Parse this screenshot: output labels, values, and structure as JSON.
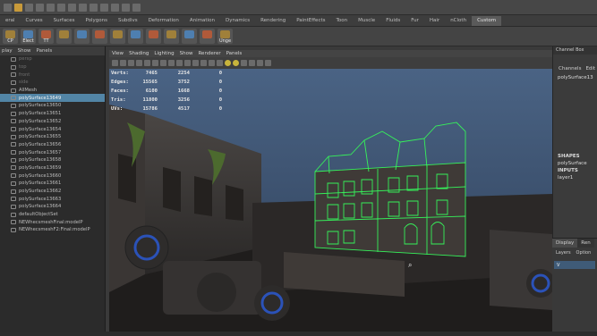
{
  "shelf_tabs": [
    {
      "label": "eral"
    },
    {
      "label": "Curves"
    },
    {
      "label": "Surfaces"
    },
    {
      "label": "Polygons"
    },
    {
      "label": "Subdivs"
    },
    {
      "label": "Deformation"
    },
    {
      "label": "Animation"
    },
    {
      "label": "Dynamics"
    },
    {
      "label": "Rendering"
    },
    {
      "label": "PaintEffects"
    },
    {
      "label": "Toon"
    },
    {
      "label": "Muscle"
    },
    {
      "label": "Fluids"
    },
    {
      "label": "Fur"
    },
    {
      "label": "Hair"
    },
    {
      "label": "nCloth"
    },
    {
      "label": "Custom"
    }
  ],
  "active_shelf_tab": "Custom",
  "shelf_buttons": [
    {
      "label": "CP"
    },
    {
      "label": "Elect"
    },
    {
      "label": "TT"
    },
    {
      "label": ""
    },
    {
      "label": ""
    },
    {
      "label": ""
    },
    {
      "label": ""
    },
    {
      "label": ""
    },
    {
      "label": ""
    },
    {
      "label": ""
    },
    {
      "label": ""
    },
    {
      "label": ""
    },
    {
      "label": "Unge"
    }
  ],
  "outliner": {
    "menu": [
      "play",
      "Show",
      "Panels"
    ],
    "rows": [
      {
        "label": "persp",
        "state": "dim"
      },
      {
        "label": "top",
        "state": "dim"
      },
      {
        "label": "front",
        "state": "dim"
      },
      {
        "label": "side",
        "state": "dim"
      },
      {
        "label": "AllMesh",
        "state": "normal"
      },
      {
        "label": "polySurface13649",
        "state": "selected"
      },
      {
        "label": "polySurface13650",
        "state": "normal"
      },
      {
        "label": "polySurface13651",
        "state": "normal"
      },
      {
        "label": "polySurface13652",
        "state": "normal"
      },
      {
        "label": "polySurface13654",
        "state": "normal"
      },
      {
        "label": "polySurface13655",
        "state": "normal"
      },
      {
        "label": "polySurface13656",
        "state": "normal"
      },
      {
        "label": "polySurface13657",
        "state": "normal"
      },
      {
        "label": "polySurface13658",
        "state": "normal"
      },
      {
        "label": "polySurface13659",
        "state": "normal"
      },
      {
        "label": "polySurface13660",
        "state": "normal"
      },
      {
        "label": "polySurface13661",
        "state": "normal"
      },
      {
        "label": "polySurface13662",
        "state": "normal"
      },
      {
        "label": "polySurface13663",
        "state": "normal"
      },
      {
        "label": "polySurface13664",
        "state": "normal"
      },
      {
        "label": "defaultObjectSet",
        "state": "normal"
      },
      {
        "label": "NEWhecsmeshFinal:modelP",
        "state": "normal"
      },
      {
        "label": "NEWhecsmeshF2:Final:modelP",
        "state": "normal"
      }
    ]
  },
  "viewport": {
    "menu": [
      "View",
      "Shading",
      "Lighting",
      "Show",
      "Renderer",
      "Panels"
    ],
    "hud": [
      {
        "label": "Verts:",
        "a": "7465",
        "b": "2254",
        "c": "0"
      },
      {
        "label": "Edges:",
        "a": "15565",
        "b": "3752",
        "c": "0"
      },
      {
        "label": "Faces:",
        "a": "6100",
        "b": "1668",
        "c": "0"
      },
      {
        "label": "Tris:",
        "a": "11800",
        "b": "3256",
        "c": "0"
      },
      {
        "label": "UVs:",
        "a": "15786",
        "b": "4517",
        "c": "0"
      }
    ]
  },
  "channel_box": {
    "header": "Channel Box",
    "tabs": [
      "Channels",
      "Edit"
    ],
    "object": "polySurface13",
    "shapes_label": "SHAPES",
    "shape_name": "polySurface",
    "inputs_label": "INPUTS",
    "input_name": "layer1"
  },
  "layer_panel": {
    "tabs": [
      "Display",
      "Ren"
    ],
    "menu": [
      "Layers",
      "Option"
    ],
    "layer_row": "V"
  },
  "colors": {
    "selection": "#5285a6",
    "wireframe": "#36f25a",
    "sky": "#3f5778"
  }
}
